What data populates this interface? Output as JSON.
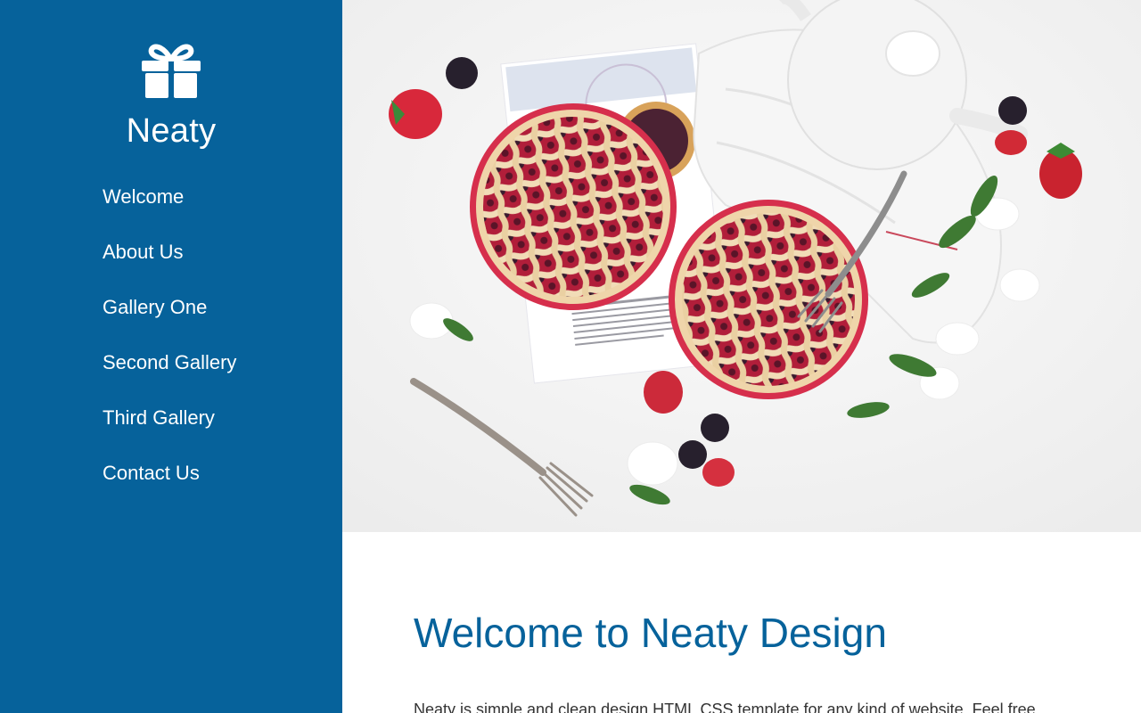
{
  "sidebar": {
    "brand_name": "Neaty",
    "brand_icon": "gift-icon",
    "nav": [
      {
        "label": "Welcome"
      },
      {
        "label": "About Us"
      },
      {
        "label": "Gallery One"
      },
      {
        "label": "Second Gallery"
      },
      {
        "label": "Third Gallery"
      },
      {
        "label": "Contact Us"
      }
    ]
  },
  "main": {
    "hero_image": "pies-and-berries-photo",
    "title": "Welcome to Neaty Design",
    "intro": "Neaty is simple and clean design HTML CSS template for any kind of website. Feel free"
  },
  "colors": {
    "sidebar_bg": "#06629b",
    "title": "#06629b",
    "body_text": "#333333"
  }
}
